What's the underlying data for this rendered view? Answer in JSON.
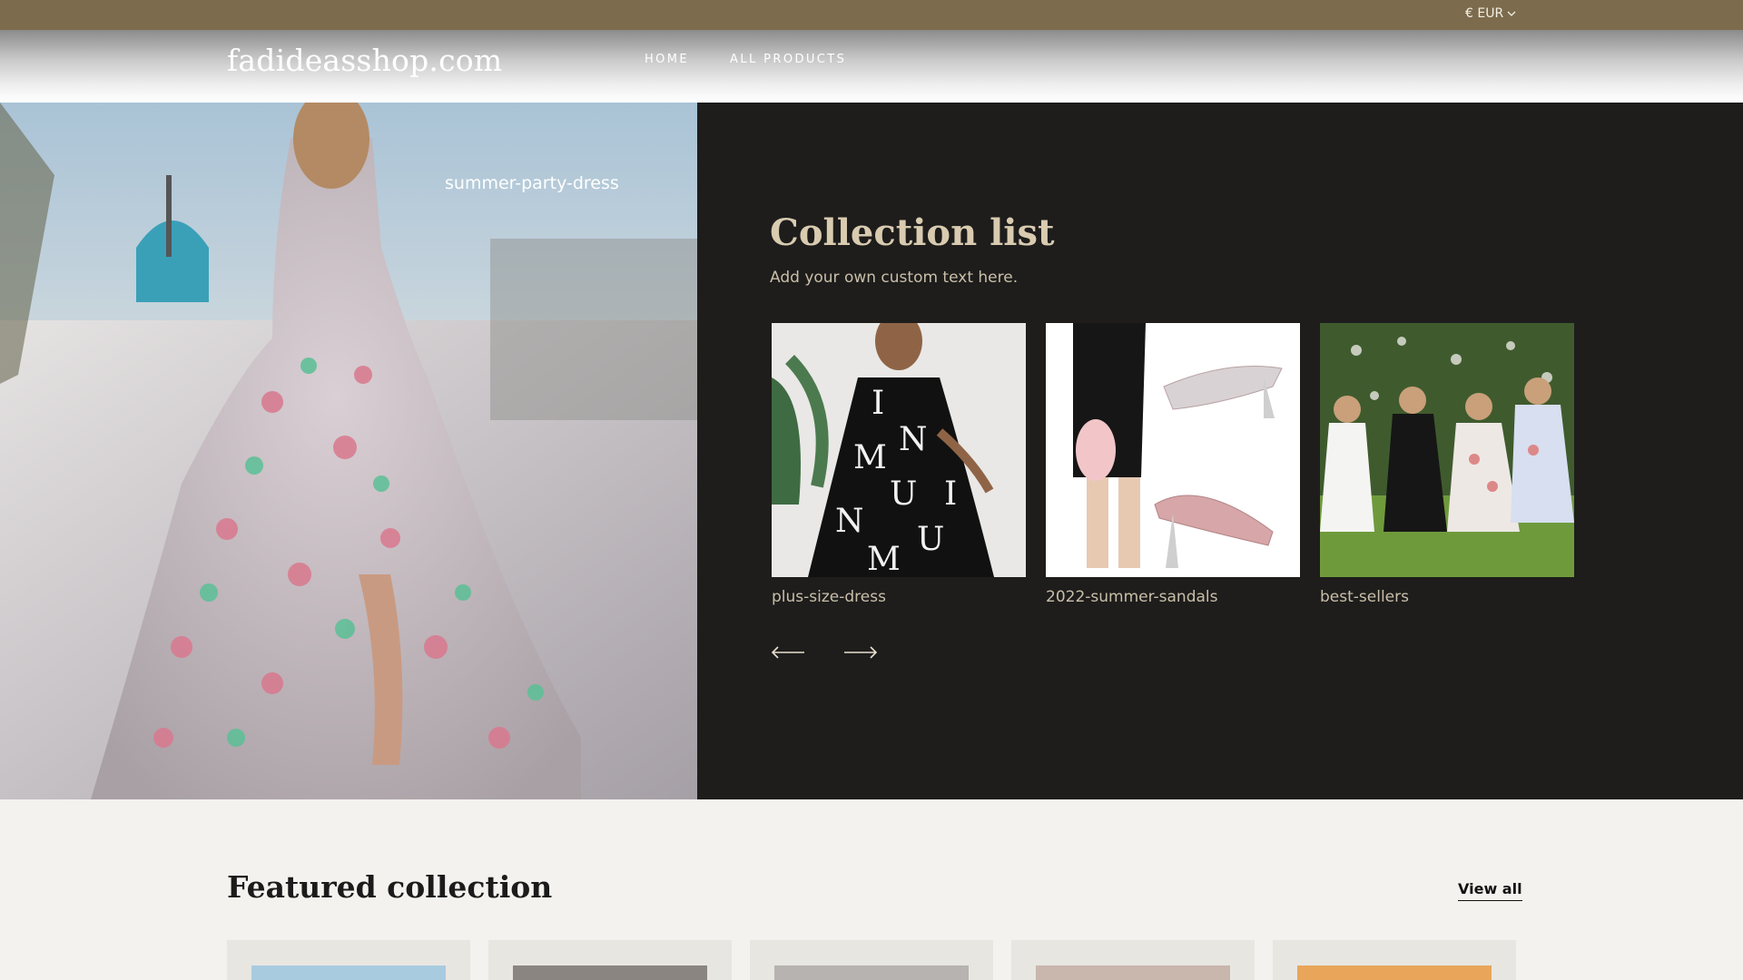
{
  "topbar": {
    "currency_label": "€ EUR"
  },
  "header": {
    "logo": "fadideasshop.com",
    "nav": [
      {
        "label": "HOME"
      },
      {
        "label": "ALL PRODUCTS"
      }
    ]
  },
  "hero": {
    "image_caption": "summer-party-dress",
    "collection_title": "Collection list",
    "collection_text": "Add your own custom text here.",
    "collections": [
      {
        "label": "plus-size-dress"
      },
      {
        "label": "2022-summer-sandals"
      },
      {
        "label": "best-sellers"
      }
    ],
    "prev_icon": "arrow-left-icon",
    "next_icon": "arrow-right-icon"
  },
  "featured": {
    "title": "Featured collection",
    "view_all": "View all"
  },
  "colors": {
    "topbar": "#7c6b4c",
    "dark_panel": "#1e1d1c",
    "accent_text": "#d9cbb0",
    "page_bg": "#f3f2ee"
  }
}
